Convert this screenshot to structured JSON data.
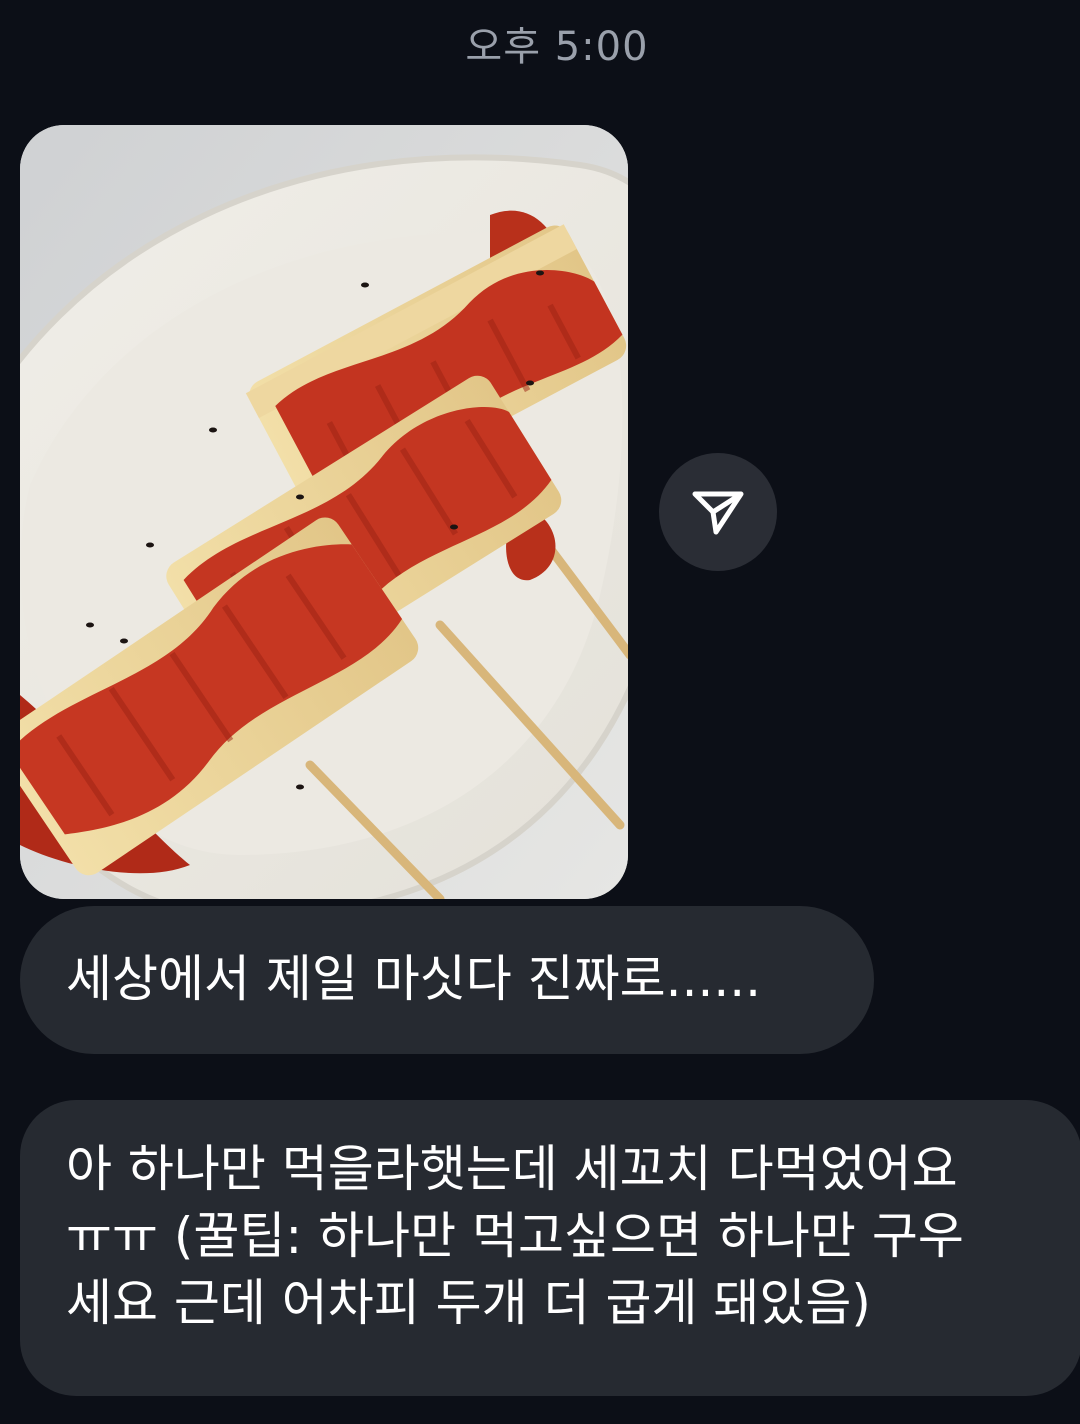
{
  "thread": {
    "timestamp": "오후 5:00"
  },
  "photo_message": {
    "alt": "tteokbokki skewers with red sauce on a white plate"
  },
  "share_button": {
    "icon": "send-paper-plane-icon"
  },
  "messages": [
    {
      "lines": [
        "세상에서 제일 마싯다 진짜로......"
      ]
    },
    {
      "lines": [
        "아 하나만 먹을라햇는데 세꼬치 다먹었어요",
        "ㅠㅠ (꿀팁: 하나만 먹고싶으면 하나만 구우",
        "세요 근데 어차피 두개 더 굽게 돼있음)"
      ]
    }
  ],
  "colors": {
    "background": "#0c0f17",
    "bubble": "#262a31",
    "timestamp": "#9aa0ab",
    "share_button": "#2a2d35",
    "sauce": "#c0311c"
  }
}
